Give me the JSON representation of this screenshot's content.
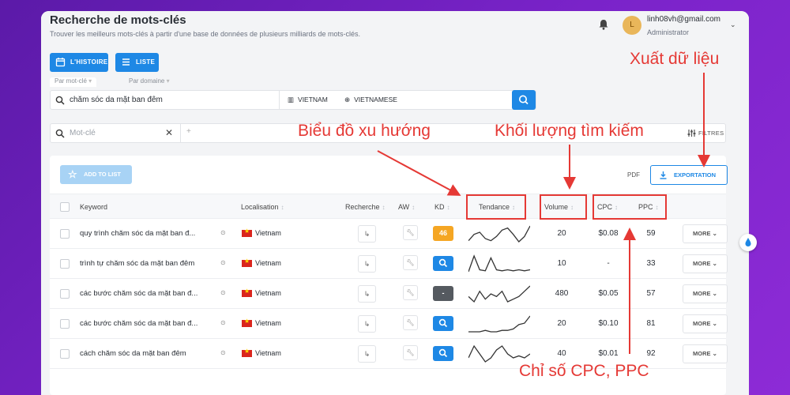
{
  "header": {
    "title": "Recherche de mots-clés",
    "subtitle": "Trouver les meilleurs mots-clés à partir d'une base de données de plusieurs milliards de mots-clés.",
    "user_initial": "L",
    "user_email": "linh08vh@gmail.com",
    "user_role": "Administrator"
  },
  "toolbar": {
    "history_label": "L'HISTOIRE",
    "list_label": "LISTE"
  },
  "search_tabs": [
    {
      "label": "Par mot-clé"
    },
    {
      "label": "Par domaine"
    }
  ],
  "search": {
    "query": "chăm sóc da mặt ban đêm",
    "country": "VIETNAM",
    "language": "VIETNAMESE"
  },
  "filter": {
    "placeholder": "Mot-clé",
    "filters_label": "FILTRES"
  },
  "actions": {
    "add_to_list": "ADD TO LIST",
    "pdf": "PDF",
    "export": "EXPORTATION"
  },
  "table": {
    "headers": {
      "keyword": "Keyword",
      "location": "Localisation",
      "search": "Recherche",
      "aw": "AW",
      "kd": "KD",
      "trend": "Tendance",
      "volume": "Volume",
      "cpc": "CPC",
      "ppc": "PPC"
    },
    "more_label": "MORE",
    "rows": [
      {
        "keyword": "quy trình chăm sóc da mặt ban đ...",
        "location": "Vietnam",
        "kd": "46",
        "kd_color": "#f5a623",
        "trend": [
          4,
          10,
          12,
          6,
          4,
          8,
          14,
          16,
          10,
          3,
          8,
          18
        ],
        "volume": "20",
        "cpc": "$0.08",
        "ppc": "59"
      },
      {
        "keyword": "trình tự chăm sóc da mặt ban đêm",
        "location": "Vietnam",
        "kd": "search-icon",
        "kd_color": "#1e88e5",
        "trend": [
          2,
          18,
          4,
          3,
          16,
          4,
          3,
          4,
          3,
          4,
          3,
          4
        ],
        "volume": "10",
        "cpc": "-",
        "ppc": "33"
      },
      {
        "keyword": "các bước chăm sóc da mặt ban đ...",
        "location": "Vietnam",
        "kd": "-",
        "kd_color": "#555a60",
        "trend": [
          10,
          8,
          12,
          9,
          11,
          10,
          12,
          8,
          9,
          10,
          12,
          14
        ],
        "volume": "480",
        "cpc": "$0.05",
        "ppc": "57"
      },
      {
        "keyword": "các bước chăm sóc da mặt ban đ...",
        "location": "Vietnam",
        "kd": "search-icon",
        "kd_color": "#1e88e5",
        "trend": [
          3,
          3,
          3,
          4,
          3,
          3,
          4,
          4,
          5,
          8,
          9,
          14
        ],
        "volume": "20",
        "cpc": "$0.10",
        "ppc": "81"
      },
      {
        "keyword": "cách chăm sóc da mặt ban đêm",
        "location": "Vietnam",
        "kd": "search-icon",
        "kd_color": "#1e88e5",
        "trend": [
          8,
          14,
          10,
          6,
          8,
          12,
          14,
          10,
          8,
          9,
          8,
          10
        ],
        "volume": "40",
        "cpc": "$0.01",
        "ppc": "92"
      }
    ]
  },
  "annotations": {
    "export": "Xuất dữ liệu",
    "trend": "Biểu đồ xu hướng",
    "volume": "Khối lượng tìm kiếm",
    "cpc_ppc": "Chỉ số CPC, PPC"
  },
  "colors": {
    "accent": "#1e88e5",
    "annotation": "#e53935"
  }
}
